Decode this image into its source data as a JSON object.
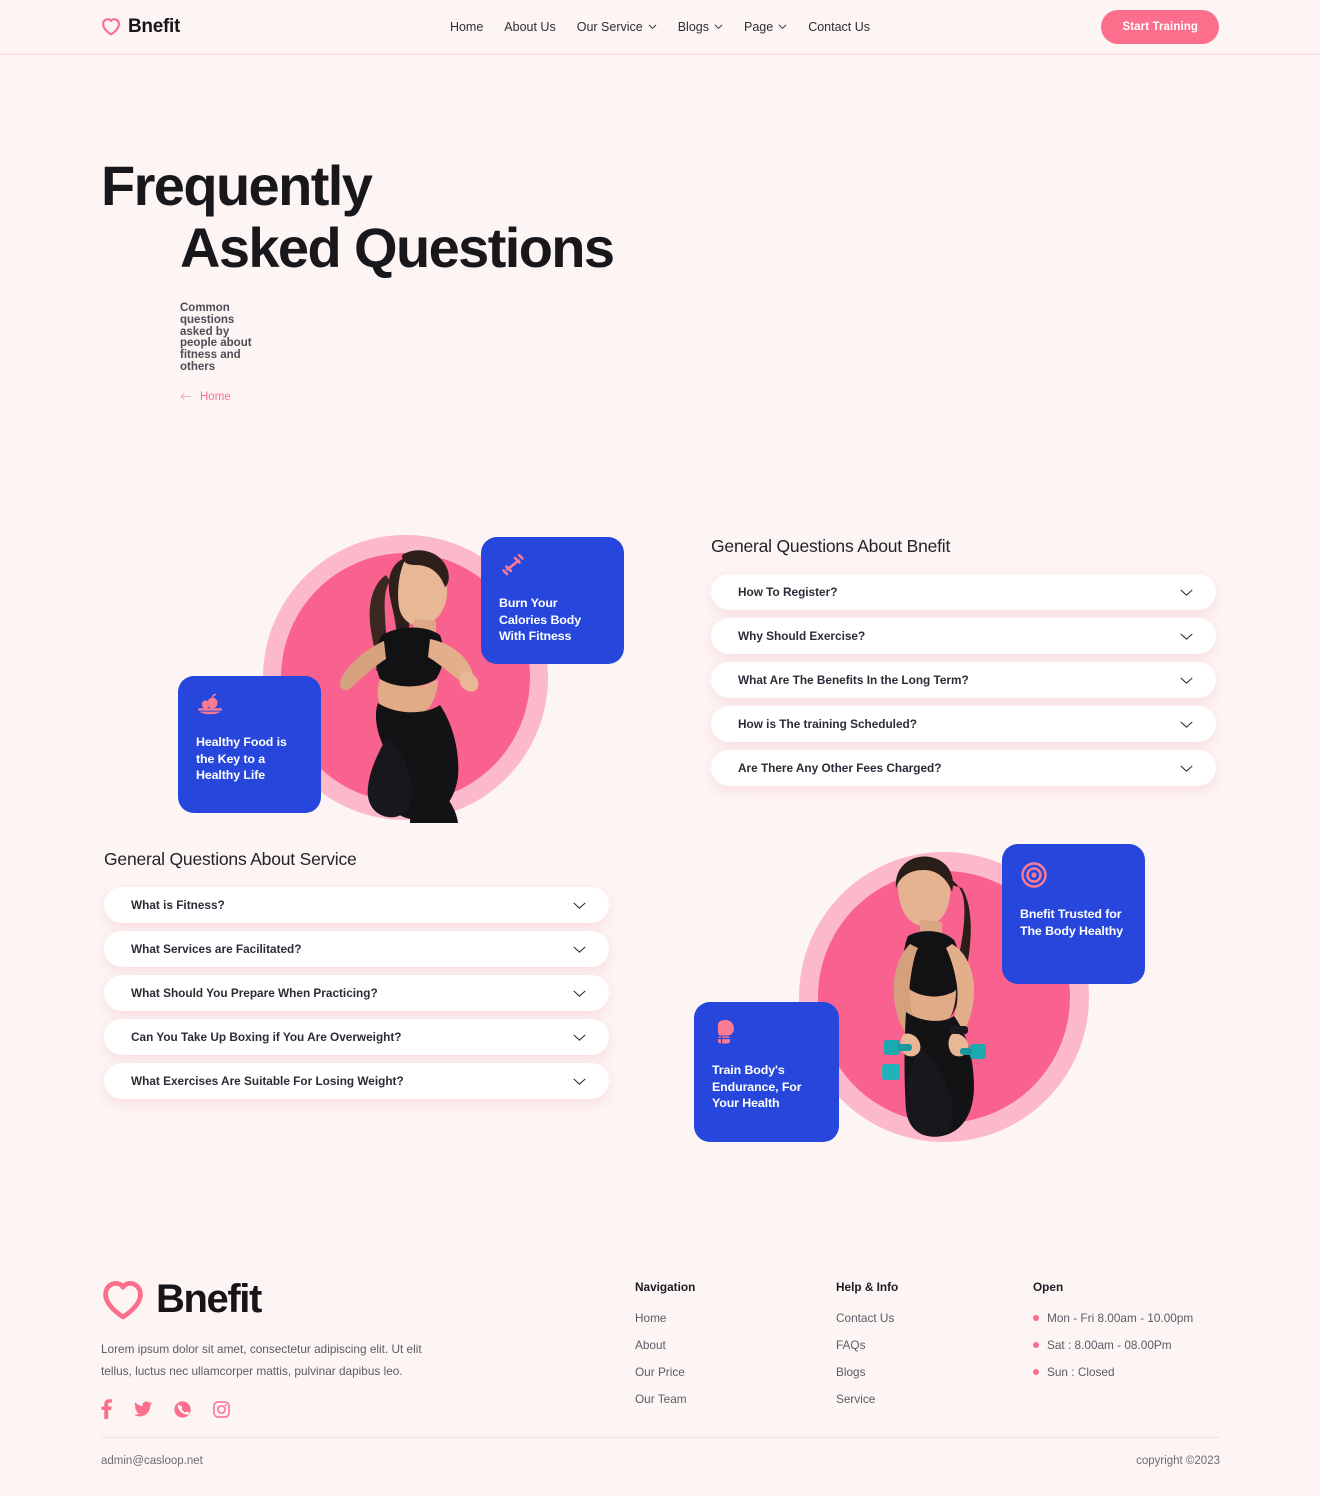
{
  "brand": {
    "name": "Bnefit",
    "heart_icon": "heart-icon"
  },
  "header": {
    "nav": [
      {
        "label": "Home",
        "has_caret": false
      },
      {
        "label": "About Us",
        "has_caret": false
      },
      {
        "label": "Our Service",
        "has_caret": true
      },
      {
        "label": "Blogs",
        "has_caret": true
      },
      {
        "label": "Page",
        "has_caret": true
      },
      {
        "label": "Contact Us",
        "has_caret": false
      }
    ],
    "cta_label": "Start Training"
  },
  "hero": {
    "title_line1": "Frequently",
    "title_line2": "Asked Questions",
    "subtitle": "Common questions asked by people about fitness and others",
    "breadcrumb_label": "Home"
  },
  "faq_bnefit": {
    "title": "General Questions About Bnefit",
    "items": [
      {
        "question": "How To Register?"
      },
      {
        "question": "Why Should Exercise?"
      },
      {
        "question": "What Are The Benefits In the Long Term?"
      },
      {
        "question": "How is The training Scheduled?"
      },
      {
        "question": "Are There Any Other Fees Charged?"
      }
    ]
  },
  "faq_service": {
    "title": "General Questions About Service",
    "items": [
      {
        "question": "What is Fitness?"
      },
      {
        "question": "What Services are Facilitated?"
      },
      {
        "question": "What Should You Prepare When Practicing?"
      },
      {
        "question": "Can You Take Up Boxing if You Are Overweight?"
      },
      {
        "question": "What Exercises Are Suitable For Losing Weight?"
      }
    ]
  },
  "visual_cards": {
    "burn": {
      "text": "Burn Your Calories Body With Fitness",
      "icon": "dumbbell-icon"
    },
    "healthy_food": {
      "text": "Healthy Food is the Key to a Healthy Life",
      "icon": "fruit-plate-icon"
    },
    "trusted": {
      "text": "Bnefit Trusted for The Body Healthy",
      "icon": "target-icon"
    },
    "train": {
      "text": "Train Body's Endurance, For Your Health",
      "icon": "boxing-glove-icon"
    }
  },
  "footer": {
    "description": "Lorem ipsum dolor sit amet, consectetur adipiscing elit. Ut elit tellus, luctus nec ullamcorper mattis, pulvinar dapibus leo.",
    "social": [
      "facebook-icon",
      "twitter-icon",
      "whatsapp-icon",
      "instagram-icon"
    ],
    "navigation": {
      "title": "Navigation",
      "items": [
        "Home",
        "About",
        "Our Price",
        "Our Team"
      ]
    },
    "help": {
      "title": "Help & Info",
      "items": [
        "Contact Us",
        "FAQs",
        "Blogs",
        "Service"
      ]
    },
    "open": {
      "title": "Open",
      "items": [
        "Mon - Fri 8.00am - 10.00pm",
        "Sat : 8.00am - 08.00Pm",
        "Sun : Closed"
      ]
    },
    "email": "admin@casloop.net",
    "copyright": "copyright ©2023"
  },
  "colors": {
    "page_bg": "#fdf5f4",
    "accent_pink": "#fb6f8d",
    "card_blue": "#2747dc",
    "circle_outer": "#fcb9cc",
    "circle_inner": "#f9628f",
    "text_dark": "#18181c"
  }
}
